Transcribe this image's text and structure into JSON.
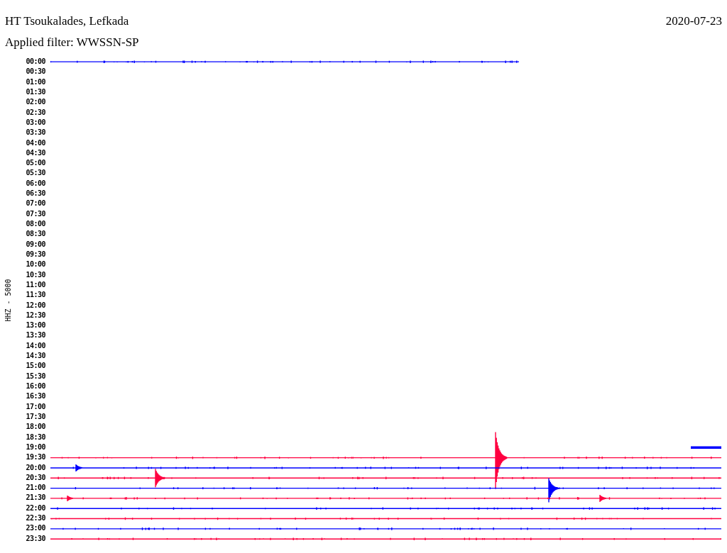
{
  "header": {
    "station": "HT Tsoukalades, Lefkada",
    "date": "2020-07-23",
    "filter": "Applied filter: WWSSN-SP"
  },
  "channel_label": "HHZ - 5000",
  "rows": [
    {
      "time": "00:00",
      "kind": "start",
      "color": "#0000ff"
    },
    {
      "time": "00:30",
      "kind": "empty"
    },
    {
      "time": "01:00",
      "kind": "empty"
    },
    {
      "time": "01:30",
      "kind": "empty"
    },
    {
      "time": "02:00",
      "kind": "empty"
    },
    {
      "time": "02:30",
      "kind": "empty"
    },
    {
      "time": "03:00",
      "kind": "empty"
    },
    {
      "time": "03:30",
      "kind": "empty"
    },
    {
      "time": "04:00",
      "kind": "empty"
    },
    {
      "time": "04:30",
      "kind": "empty"
    },
    {
      "time": "05:00",
      "kind": "empty"
    },
    {
      "time": "05:30",
      "kind": "empty"
    },
    {
      "time": "06:00",
      "kind": "empty"
    },
    {
      "time": "06:30",
      "kind": "empty"
    },
    {
      "time": "07:00",
      "kind": "empty"
    },
    {
      "time": "07:30",
      "kind": "empty"
    },
    {
      "time": "08:00",
      "kind": "empty"
    },
    {
      "time": "08:30",
      "kind": "empty"
    },
    {
      "time": "09:00",
      "kind": "empty"
    },
    {
      "time": "09:30",
      "kind": "empty"
    },
    {
      "time": "10:00",
      "kind": "empty"
    },
    {
      "time": "10:30",
      "kind": "empty"
    },
    {
      "time": "11:00",
      "kind": "empty"
    },
    {
      "time": "11:30",
      "kind": "empty"
    },
    {
      "time": "12:00",
      "kind": "empty"
    },
    {
      "time": "12:30",
      "kind": "empty"
    },
    {
      "time": "13:00",
      "kind": "empty"
    },
    {
      "time": "13:30",
      "kind": "empty"
    },
    {
      "time": "14:00",
      "kind": "empty"
    },
    {
      "time": "14:30",
      "kind": "empty"
    },
    {
      "time": "15:00",
      "kind": "empty"
    },
    {
      "time": "15:30",
      "kind": "empty"
    },
    {
      "time": "16:00",
      "kind": "empty"
    },
    {
      "time": "16:30",
      "kind": "empty"
    },
    {
      "time": "17:00",
      "kind": "empty"
    },
    {
      "time": "17:30",
      "kind": "empty"
    },
    {
      "time": "18:00",
      "kind": "empty"
    },
    {
      "time": "18:30",
      "kind": "empty"
    },
    {
      "time": "19:00",
      "kind": "end",
      "color": "#0000ff"
    },
    {
      "time": "19:30",
      "kind": "full",
      "color": "#ff0040"
    },
    {
      "time": "20:00",
      "kind": "full",
      "color": "#0000ff"
    },
    {
      "time": "20:30",
      "kind": "full",
      "color": "#ff0040"
    },
    {
      "time": "21:00",
      "kind": "full",
      "color": "#0000ff"
    },
    {
      "time": "21:30",
      "kind": "full",
      "color": "#ff0040"
    },
    {
      "time": "22:00",
      "kind": "full",
      "color": "#0000ff"
    },
    {
      "time": "22:30",
      "kind": "full",
      "color": "#ff0040"
    },
    {
      "time": "23:00",
      "kind": "full",
      "color": "#0000ff"
    },
    {
      "time": "23:30",
      "kind": "full",
      "color": "#ff0040"
    }
  ]
}
